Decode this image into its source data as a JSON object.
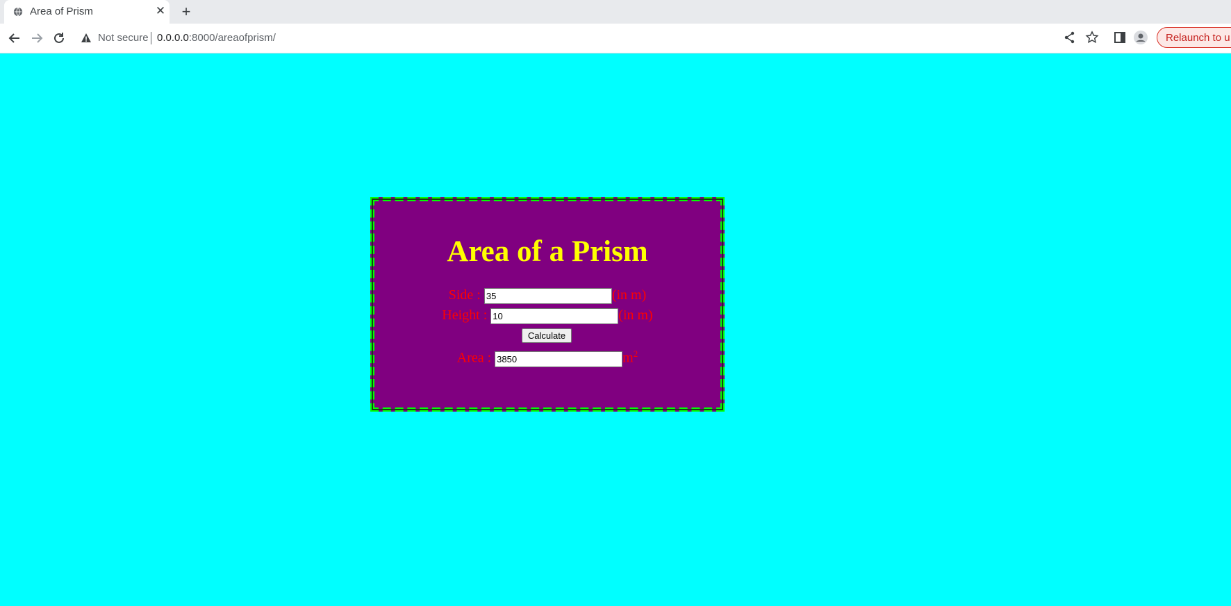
{
  "browser": {
    "tab_title": "Area of Prism",
    "tab_close": "✕",
    "new_tab": "+",
    "security_label": "Not secure",
    "url_host": "0.0.0.0",
    "url_path": ":8000/areaofprism/",
    "relaunch_label": "Relaunch to u"
  },
  "page": {
    "heading": "Area of a Prism",
    "side_label": "Side : ",
    "side_value": "35",
    "side_unit": "(in m)",
    "height_label": "Height : ",
    "height_value": "10",
    "height_unit": "(in m)",
    "calculate_label": "Calculate",
    "area_label": "Area : ",
    "area_value": "3850",
    "area_unit": "m",
    "area_unit_sup": "2"
  },
  "colors": {
    "page_background": "#00ffff",
    "card_background": "#800080",
    "card_border": "#00ff00",
    "heading": "#ffff00",
    "label_text": "#ff0000"
  }
}
